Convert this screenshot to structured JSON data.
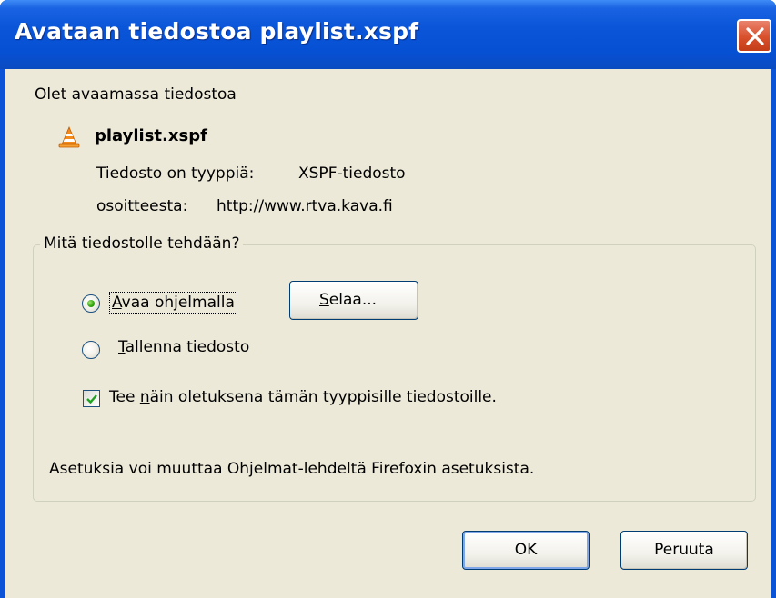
{
  "window": {
    "title": "Avataan tiedostoa playlist.xspf"
  },
  "intro_text": "Olet avaamassa tiedostoa",
  "file": {
    "icon": "vlc-cone-icon",
    "name": "playlist.xspf",
    "type_label": "Tiedosto on tyyppiä:",
    "type_value": "XSPF-tiedosto",
    "source_label": "osoitteesta:",
    "source_value": "http://www.rtva.kava.fi"
  },
  "action_group": {
    "legend": "Mitä tiedostolle tehdään?",
    "open_with": {
      "label": "Avaa ohjelmalla",
      "selected": true
    },
    "browse_button": "Selaa...",
    "save_file": {
      "label": "Tallenna tiedosto",
      "selected": false
    },
    "default_checkbox": {
      "label": "Tee näin oletuksena tämän tyyppisille tiedostoille.",
      "checked": true
    }
  },
  "settings_note": "Asetuksia voi muuttaa Ohjelmat-lehdeltä Firefoxin asetuksista.",
  "buttons": {
    "ok": "OK",
    "cancel": "Peruuta"
  },
  "colors": {
    "titlebar": "#0650d4",
    "dialog_bg": "#ece9d8",
    "close_button": "#d8502c",
    "accent_green": "#2ea40e"
  }
}
